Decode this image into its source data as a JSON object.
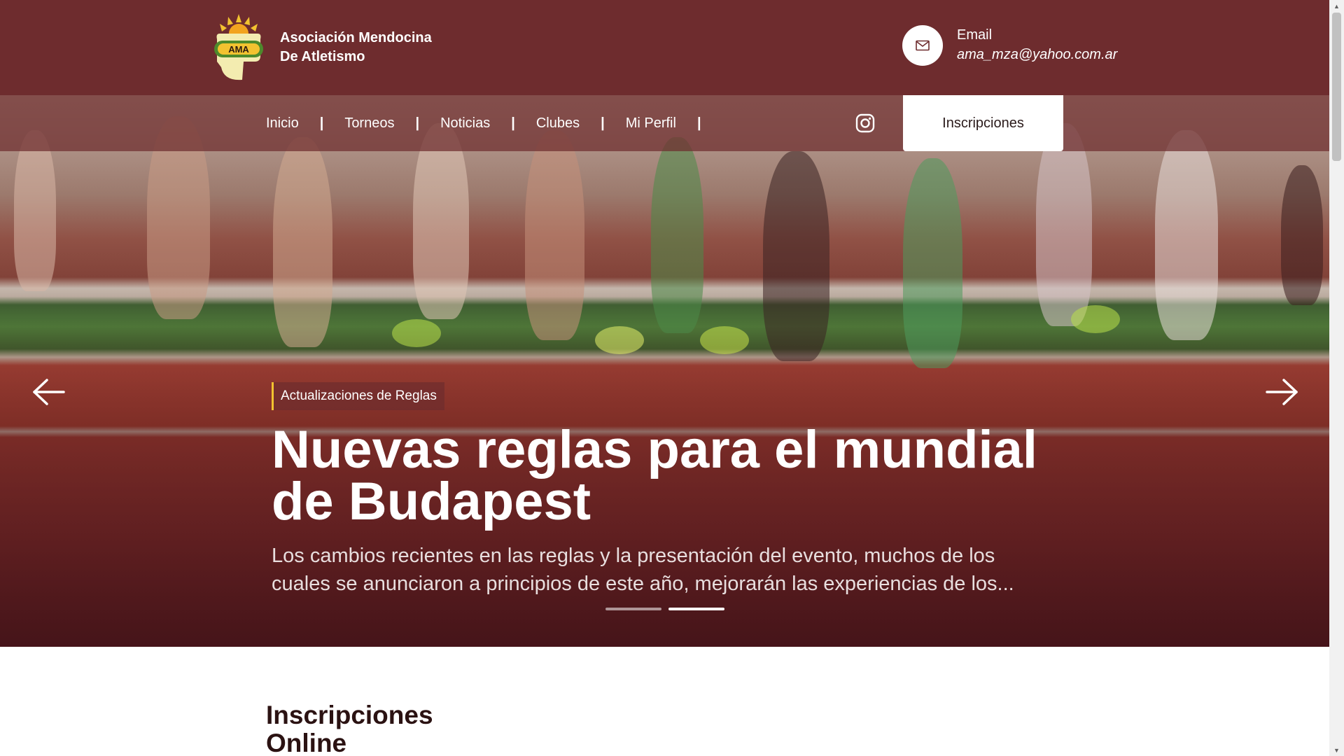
{
  "header": {
    "brand": {
      "logo_text": "AMA",
      "name_line1": "Asociación Mendocina",
      "name_line2": "De Atletismo"
    },
    "contact": {
      "label": "Email",
      "email": "ama_mza@yahoo.com.ar",
      "icon": "mail-icon"
    }
  },
  "nav": {
    "items": [
      {
        "label": "Inicio"
      },
      {
        "label": "Torneos"
      },
      {
        "label": "Noticias"
      },
      {
        "label": "Clubes"
      },
      {
        "label": "Mi Perfil"
      }
    ],
    "separator": "|",
    "social_icon": "instagram-icon",
    "cta_label": "Inscripciones"
  },
  "hero": {
    "category": "Actualizaciones de Reglas",
    "headline_line1": "Nuevas reglas para el mundial",
    "headline_line2": "de Budapest",
    "excerpt_line1": "Los cambios recientes en las reglas y la presentación del evento, muchos de los",
    "excerpt_line2": "cuales se anunciaron a principios de este año, mejorarán las experiencias de los...",
    "prev_icon": "arrow-left-icon",
    "next_icon": "arrow-right-icon",
    "slide_count": 2,
    "active_slide": 2
  },
  "section": {
    "title_line1": "Inscripciones",
    "title_line2": "Online"
  },
  "colors": {
    "brand_dark": "#6e2c2e",
    "accent_yellow": "#f2c230",
    "white": "#ffffff",
    "heading_dark": "#2b1212"
  }
}
